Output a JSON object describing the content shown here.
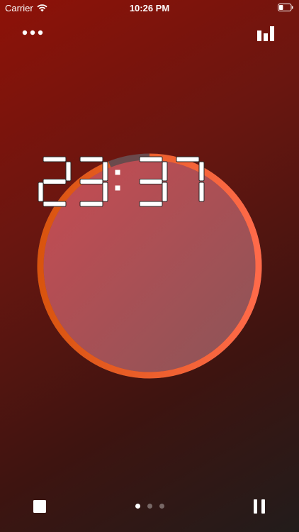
{
  "status_bar": {
    "carrier": "Carrier",
    "time": "10:26 PM",
    "wifi_icon": "wifi-icon",
    "battery_icon": "battery-icon",
    "battery_level": 0.35
  },
  "toolbar": {
    "more_icon": "more-horizontal-icon",
    "stats_icon": "bar-chart-icon"
  },
  "timer": {
    "display": "23:37",
    "minutes": "23",
    "seconds": "37",
    "progress_remaining": 0.94,
    "ring_color_top": "#d9540e",
    "ring_color_bottom": "#ff6a4a",
    "track_color": "#6a4a4c",
    "face_color": "#b8535c"
  },
  "controls": {
    "stop_icon": "stop-icon",
    "pause_icon": "pause-icon"
  },
  "pagination": {
    "total_pages": 3,
    "current_page": 1
  }
}
